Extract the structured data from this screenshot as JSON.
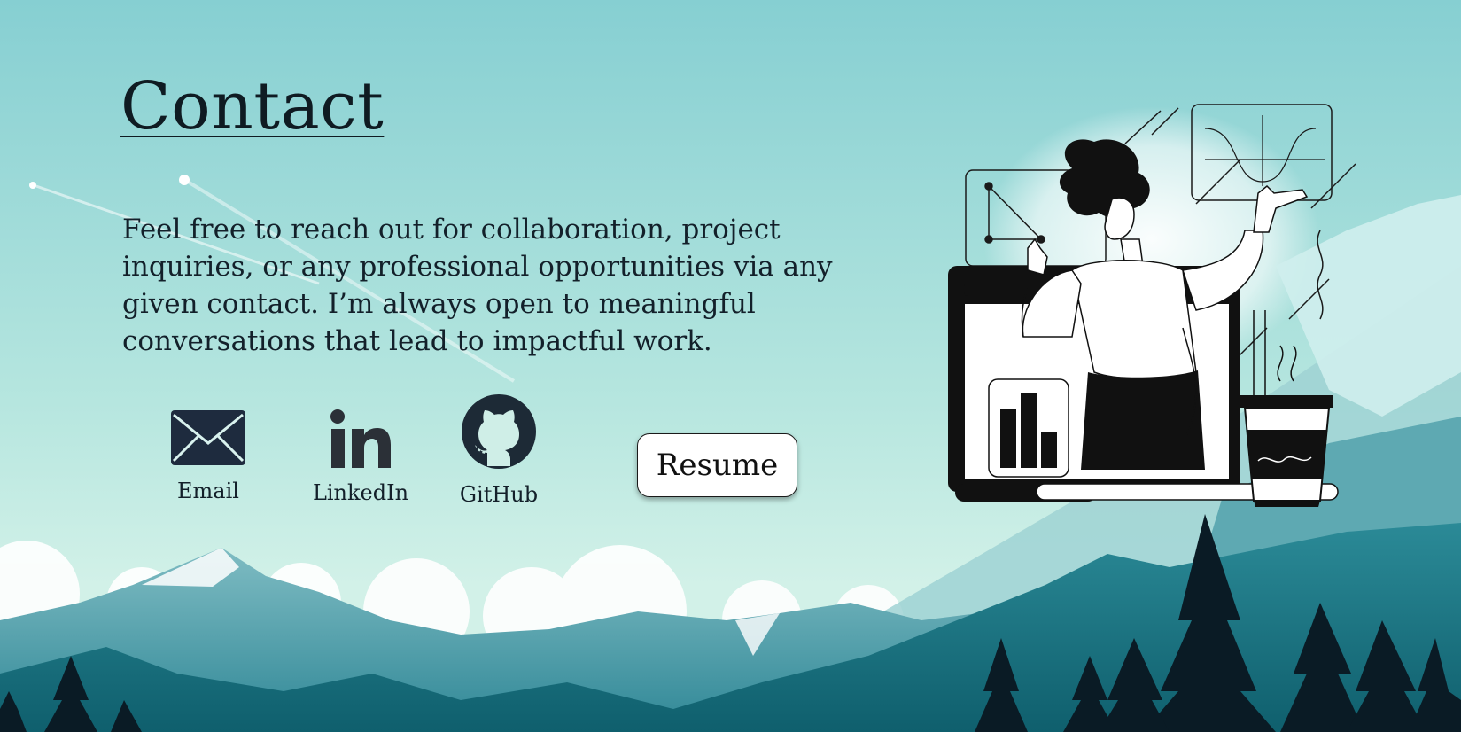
{
  "page": {
    "title": "Contact",
    "description": "Feel free to reach out for collaboration, project inquiries, or any professional opportunities via any given contact. I’m always open to meaningful conversations that lead to impactful work."
  },
  "contacts": [
    {
      "label": "Email",
      "icon": "envelope-icon"
    },
    {
      "label": "LinkedIn",
      "icon": "linkedin-icon"
    },
    {
      "label": "GitHub",
      "icon": "github-icon"
    }
  ],
  "resume": {
    "label": "Resume"
  },
  "colors": {
    "sky_top": "#86cfd2",
    "sky_bottom": "#cdeee6",
    "mountain_mid": "#4a9aa6",
    "mountain_dark": "#0f6f7c",
    "trees": "#0a1b25",
    "icon": "#1e2b3e"
  }
}
